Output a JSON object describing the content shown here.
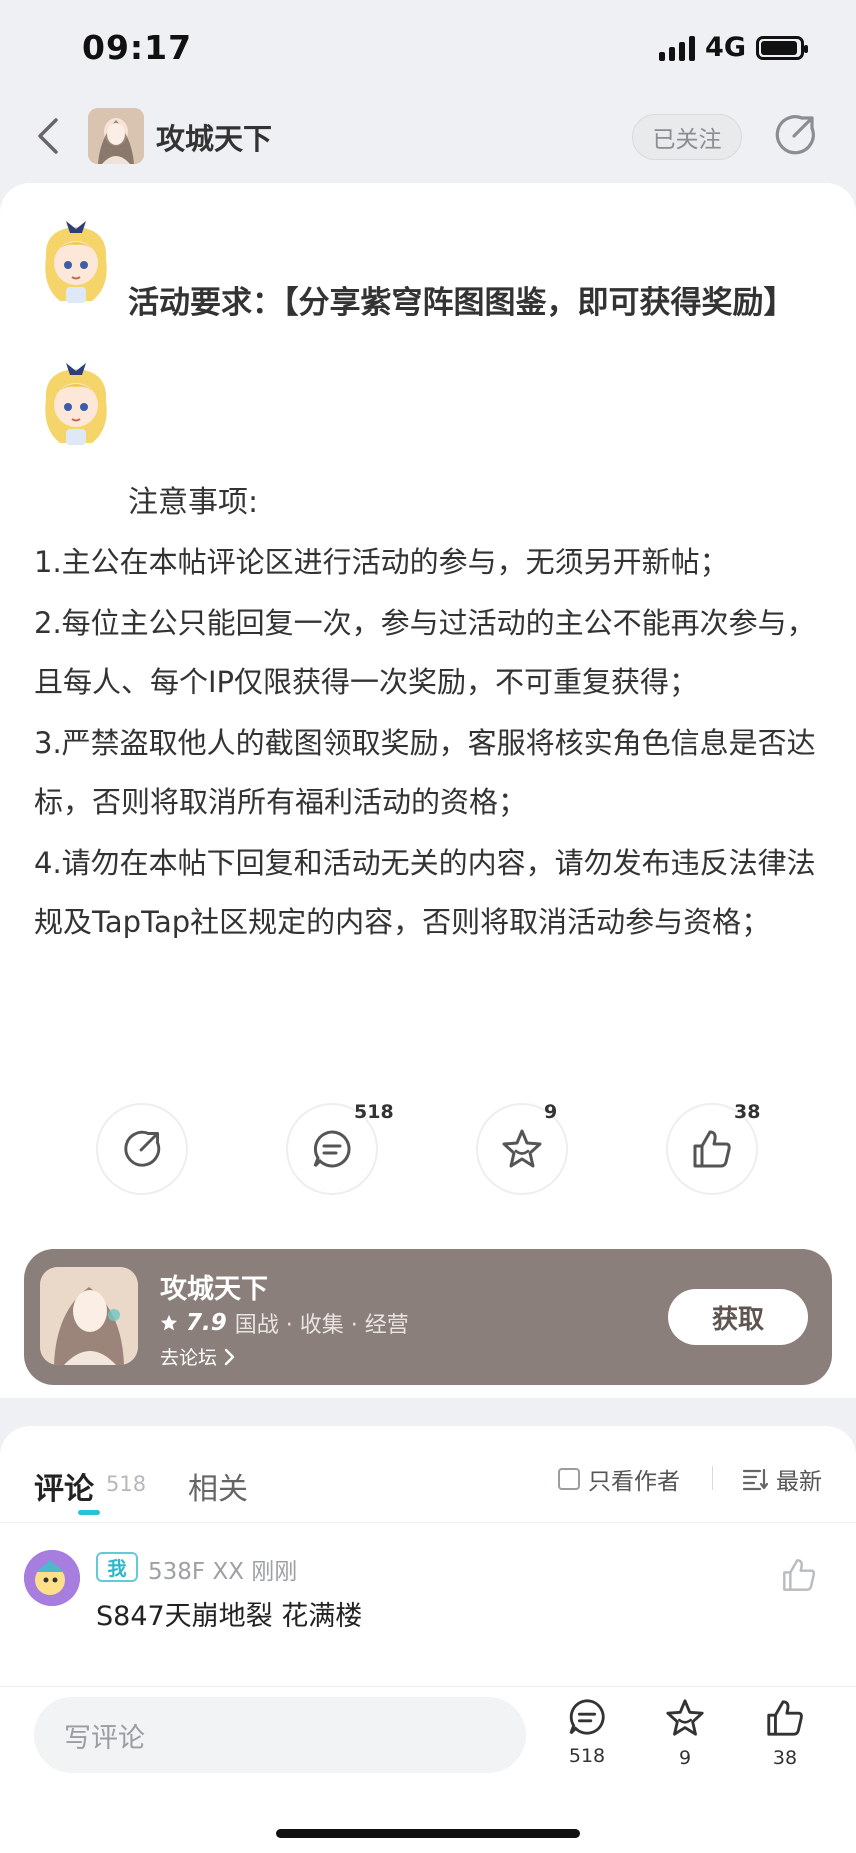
{
  "status_bar": {
    "time": "09:17",
    "network": "4G"
  },
  "nav": {
    "title": "攻城天下",
    "follow_label": "已关注",
    "back_icon": "chevron-left-icon",
    "share_icon": "share-icon"
  },
  "post": {
    "requirement": "活动要求：【分享紫穹阵图图鉴，即可获得奖励】",
    "notice_title": "注意事项:",
    "rules": [
      "1.主公在本帖评论区进行活动的参与，无须另开新帖；",
      "2.每位主公只能回复一次，参与过活动的主公不能再次参与，且每人、每个IP仅限获得一次奖励，不可重复获得；",
      "3.严禁盗取他人的截图领取奖励，客服将核实角色信息是否达标，否则将取消所有福利活动的资格；",
      "4.请勿在本帖下回复和活动无关的内容，请勿发布违反法律法规及TapTap社区规定的内容，否则将取消活动参与资格；"
    ]
  },
  "actions": {
    "comments": "518",
    "favorites": "9",
    "likes": "38"
  },
  "app_card": {
    "name": "攻城天下",
    "score": "7.9",
    "tags": "国战 · 收集 · 经营",
    "forum_link": "去论坛",
    "get_label": "获取",
    "bg_color": "#8a7f7a"
  },
  "comments_section": {
    "tab_comments": "评论",
    "tab_comments_count": "518",
    "tab_related": "相关",
    "only_author": "只看作者",
    "sort_label": "最新",
    "accent": "#27c3d6",
    "items": [
      {
        "badge": "我",
        "meta": "538F XX 刚刚",
        "text": "S847天崩地裂 花满楼"
      }
    ]
  },
  "bottom_bar": {
    "placeholder": "写评论",
    "comments": "518",
    "favorites": "9",
    "likes": "38"
  }
}
